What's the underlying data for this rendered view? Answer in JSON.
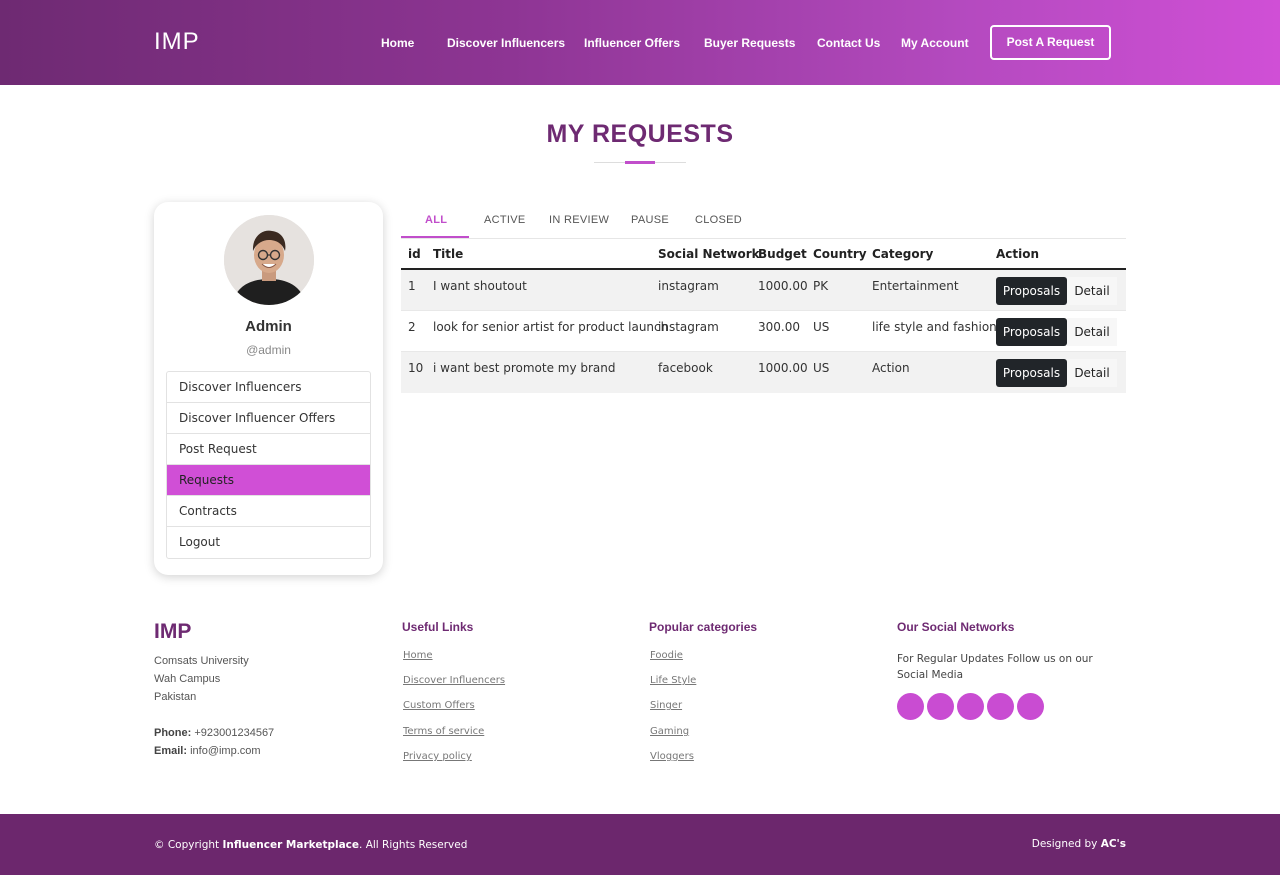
{
  "header": {
    "logo": "IMP",
    "nav": [
      "Home",
      "Discover Influencers",
      "Influencer Offers",
      "Buyer Requests",
      "Contact Us",
      "My Account"
    ],
    "post_button": "Post A Request"
  },
  "page_title": "MY REQUESTS",
  "profile": {
    "name": "Admin",
    "handle": "@admin",
    "menu": [
      "Discover Influencers",
      "Discover Influencer Offers",
      "Post Request",
      "Requests",
      "Contracts",
      "Logout"
    ],
    "active_item": "Requests"
  },
  "tabs": [
    "ALL",
    "ACTIVE",
    "IN REVIEW",
    "PAUSE",
    "CLOSED"
  ],
  "active_tab": "ALL",
  "table": {
    "headers": [
      "id",
      "Title",
      "Social Network",
      "Budget",
      "Country",
      "Category",
      "Action"
    ],
    "rows": [
      {
        "id": "1",
        "title": "I want shoutout",
        "network": "instagram",
        "budget": "1000.00",
        "country": "PK",
        "category": "Entertainment"
      },
      {
        "id": "2",
        "title": "look for senior artist for product launch",
        "network": "instagram",
        "budget": "300.00",
        "country": "US",
        "category": "life style and fashion"
      },
      {
        "id": "10",
        "title": "i want best promote my brand",
        "network": "facebook",
        "budget": "1000.00",
        "country": "US",
        "category": "Action"
      }
    ],
    "proposals_label": "Proposals",
    "detail_label": "Detail"
  },
  "footer": {
    "logo": "IMP",
    "address": [
      "Comsats University",
      "Wah Campus",
      "Pakistan"
    ],
    "phone_label": "Phone:",
    "phone": "+923001234567",
    "email_label": "Email:",
    "email": "info@imp.com",
    "useful_links_title": "Useful Links",
    "useful_links": [
      "Home",
      "Discover Influencers",
      "Custom Offers",
      "Terms of service",
      "Privacy policy"
    ],
    "categories_title": "Popular categories",
    "categories": [
      "Foodie",
      "Life Style",
      "Singer",
      "Gaming",
      "Vloggers"
    ],
    "social_title": "Our Social Networks",
    "social_text": "For Regular Updates Follow us on our Social Media",
    "social_icons": [
      "twitter-icon",
      "facebook-icon",
      "instagram-icon",
      "skype-icon",
      "linkedin-icon"
    ],
    "copyright_prefix": "© Copyright",
    "copyright_brand": "Influencer Marketplace",
    "copyright_suffix": ". All Rights Reserved",
    "designed_prefix": "Designed by",
    "designed_by": "AC's"
  },
  "colors": {
    "accent": "#c14ecb",
    "brand": "#6e2a72",
    "active_menu": "#d04fd6"
  }
}
